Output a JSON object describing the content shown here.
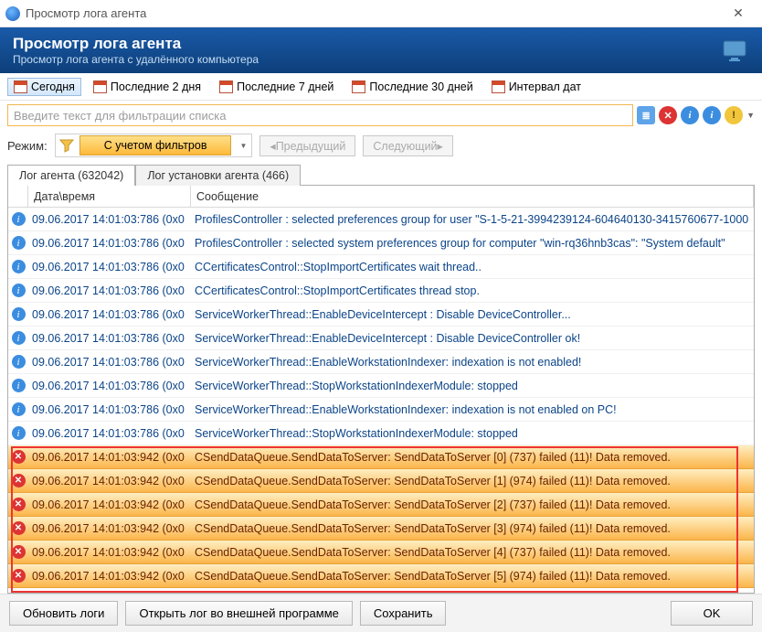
{
  "window": {
    "title": "Просмотр лога агента"
  },
  "header": {
    "title": "Просмотр лога агента",
    "subtitle": "Просмотр лога агента с удалённого компьютера"
  },
  "date_toolbar": {
    "today": "Сегодня",
    "last2": "Последние 2 дня",
    "last7": "Последние 7 дней",
    "last30": "Последние 30 дней",
    "interval": "Интервал дат"
  },
  "filter": {
    "placeholder": "Введите текст для фильтрации списка"
  },
  "mode": {
    "label": "Режим:",
    "with_filters": "С учетом фильтров",
    "prev": "Предыдущий",
    "next": "Следующий"
  },
  "tabs": {
    "agent_log": "Лог агента (632042)",
    "install_log": "Лог установки агента (466)"
  },
  "columns": {
    "datetime": "Дата\\время",
    "message": "Сообщение"
  },
  "rows": [
    {
      "type": "info",
      "dt": "09.06.2017 14:01:03:786 (0x0",
      "msg": "ProfilesController : selected preferences group for user \"S-1-5-21-3994239124-604640130-3415760677-1000"
    },
    {
      "type": "info",
      "dt": "09.06.2017 14:01:03:786 (0x0",
      "msg": "ProfilesController : selected system preferences group for computer \"win-rq36hnb3cas\": \"System default\""
    },
    {
      "type": "info",
      "dt": "09.06.2017 14:01:03:786 (0x0",
      "msg": "CCertificatesControl::StopImportCertificates wait thread.."
    },
    {
      "type": "info",
      "dt": "09.06.2017 14:01:03:786 (0x0",
      "msg": "CCertificatesControl::StopImportCertificates thread stop."
    },
    {
      "type": "info",
      "dt": "09.06.2017 14:01:03:786 (0x0",
      "msg": "ServiceWorkerThread::EnableDeviceIntercept : Disable DeviceController..."
    },
    {
      "type": "info",
      "dt": "09.06.2017 14:01:03:786 (0x0",
      "msg": "ServiceWorkerThread::EnableDeviceIntercept : Disable DeviceController ok!"
    },
    {
      "type": "info",
      "dt": "09.06.2017 14:01:03:786 (0x0",
      "msg": "ServiceWorkerThread::EnableWorkstationIndexer: indexation is not enabled!"
    },
    {
      "type": "info",
      "dt": "09.06.2017 14:01:03:786 (0x0",
      "msg": "ServiceWorkerThread::StopWorkstationIndexerModule: stopped"
    },
    {
      "type": "info",
      "dt": "09.06.2017 14:01:03:786 (0x0",
      "msg": "ServiceWorkerThread::EnableWorkstationIndexer: indexation is not enabled on PC!"
    },
    {
      "type": "info",
      "dt": "09.06.2017 14:01:03:786 (0x0",
      "msg": "ServiceWorkerThread::StopWorkstationIndexerModule: stopped"
    },
    {
      "type": "err",
      "dt": "09.06.2017 14:01:03:942 (0x0",
      "msg": "CSendDataQueue.SendDataToServer: SendDataToServer [0] (737) failed (11)! Data removed."
    },
    {
      "type": "err",
      "dt": "09.06.2017 14:01:03:942 (0x0",
      "msg": "CSendDataQueue.SendDataToServer: SendDataToServer [1] (974) failed (11)! Data removed."
    },
    {
      "type": "err",
      "dt": "09.06.2017 14:01:03:942 (0x0",
      "msg": "CSendDataQueue.SendDataToServer: SendDataToServer [2] (737) failed (11)! Data removed."
    },
    {
      "type": "err",
      "dt": "09.06.2017 14:01:03:942 (0x0",
      "msg": "CSendDataQueue.SendDataToServer: SendDataToServer [3] (974) failed (11)! Data removed."
    },
    {
      "type": "err",
      "dt": "09.06.2017 14:01:03:942 (0x0",
      "msg": "CSendDataQueue.SendDataToServer: SendDataToServer [4] (737) failed (11)! Data removed."
    },
    {
      "type": "err",
      "dt": "09.06.2017 14:01:03:942 (0x0",
      "msg": "CSendDataQueue.SendDataToServer: SendDataToServer [5] (974) failed (11)! Data removed."
    }
  ],
  "footer": {
    "refresh": "Обновить логи",
    "open_ext": "Открыть лог во внешней программе",
    "save": "Сохранить",
    "ok": "OK"
  }
}
